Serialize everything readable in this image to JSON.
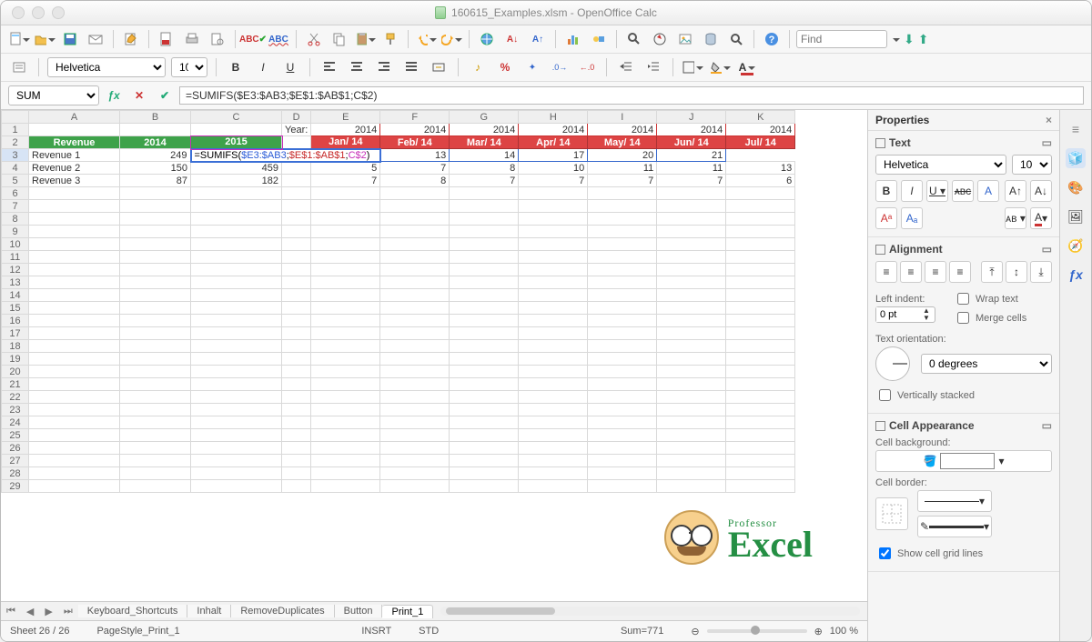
{
  "title": "160615_Examples.xlsm - OpenOffice Calc",
  "find_placeholder": "Find",
  "font": {
    "name": "Helvetica",
    "size": "10"
  },
  "namebox": "SUM",
  "formula": "=SUMIFS($E3:$AB3;$E$1:$AB$1;C$2)",
  "formula_parts": {
    "pre": "=SUMIFS(",
    "a": "$E3:$AB3",
    "b": "$E$1:$AB$1",
    "c": "C$2"
  },
  "columns": [
    "A",
    "B",
    "C",
    "D",
    "E",
    "F",
    "G",
    "H",
    "I",
    "J",
    "K"
  ],
  "col_widths": [
    "colA",
    "colB",
    "colC",
    "colD",
    "colM",
    "colM",
    "colM",
    "colM",
    "colM",
    "colM",
    "colM"
  ],
  "row1": {
    "D": "Year:",
    "E": "2014",
    "F": "2014",
    "G": "2014",
    "H": "2014",
    "I": "2014",
    "J": "2014",
    "K": "2014"
  },
  "row2": {
    "A": "Revenue",
    "B": "2014",
    "C": "2015",
    "E": "Jan/ 14",
    "F": "Feb/ 14",
    "G": "Mar/ 14",
    "H": "Apr/ 14",
    "I": "May/ 14",
    "J": "Jun/ 14",
    "K": "Jul/ 14"
  },
  "row3": {
    "A": "Revenue 1",
    "B": "249",
    "G": "13",
    "H": "14",
    "I": "17",
    "J": "20",
    "K": "21"
  },
  "row4": {
    "A": "Revenue 2",
    "B": "150",
    "C": "459",
    "E": "5",
    "F": "7",
    "G": "8",
    "H": "10",
    "I": "11",
    "J": "11",
    "K": "13"
  },
  "row5": {
    "A": "Revenue 3",
    "B": "87",
    "C": "182",
    "E": "7",
    "F": "8",
    "G": "7",
    "H": "7",
    "I": "7",
    "J": "7",
    "K": "6"
  },
  "tabs": [
    "Keyboard_Shortcuts",
    "Inhalt",
    "RemoveDuplicates",
    "Button",
    "Print_1"
  ],
  "active_tab": "Print_1",
  "status": {
    "sheet": "Sheet 26 / 26",
    "style": "PageStyle_Print_1",
    "insrt": "INSRT",
    "std": "STD",
    "sum": "Sum=771",
    "zoom": "100 %"
  },
  "props": {
    "title": "Properties",
    "text": "Text",
    "align": "Alignment",
    "left_indent": "Left indent:",
    "indent_val": "0 pt",
    "wrap": "Wrap text",
    "merge": "Merge cells",
    "orient": "Text orientation:",
    "deg": "0 degrees",
    "vstack": "Vertically stacked",
    "cellapp": "Cell Appearance",
    "cellbg": "Cell background:",
    "cellbd": "Cell border:",
    "grid": "Show cell grid lines"
  },
  "logo": {
    "top": "Professor",
    "main": "Excel"
  }
}
